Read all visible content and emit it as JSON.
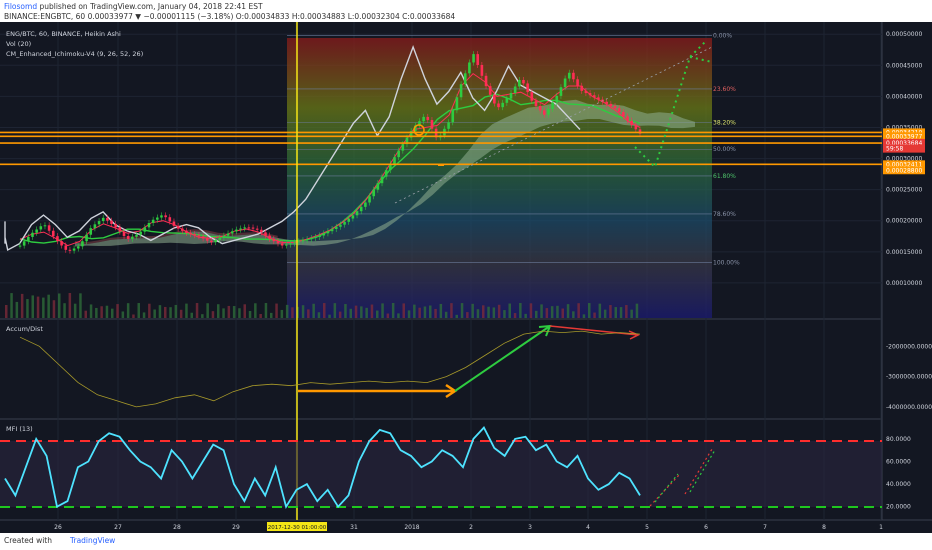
{
  "header": {
    "author": "Filosomd",
    "published": " published on TradingView.com, January 04, 2018 22:41 EST",
    "symbol_line": "BINANCE:ENGBTC, 60  0.00033977 ▼ −0.00001115 (−3.18%)  O:0.00034833  H:0.00034883  L:0.00032304  C:0.00033684"
  },
  "footer": {
    "created_with": "Created with",
    "brand": "TradingView"
  },
  "legend": {
    "title": "ENG/BTC, 60, BINANCE, Heikin Ashi",
    "vol": "Vol (20)",
    "ichimoku": "CM_Enhanced_Ichimoku-V4 (9, 26, 52, 26)",
    "accum": "Accum/Dist",
    "mfi": "MFI (13)"
  },
  "colors": {
    "background": "#131722",
    "price_line": "#cfd3dc",
    "ichimoku_green": "#2ecc40",
    "ichimoku_red": "#ff2d55",
    "fib_orange": "#ff9800",
    "vertical_marker": "#f5e616",
    "mfi": "#4ee3ff",
    "mfi_upper": "#ff2d2d",
    "mfi_lower": "#1fc71f"
  },
  "chart_data": [
    {
      "type": "line",
      "title": "ENG/BTC, 60, BINANCE, Heikin Ashi",
      "x_ticks": [
        "26",
        "27",
        "28",
        "29",
        "30",
        "31",
        "2018",
        "2",
        "3",
        "4",
        "5",
        "6",
        "7",
        "8",
        "1"
      ],
      "y_ticks": [
        "0.00050000",
        "0.00045000",
        "0.00040000",
        "0.00035000",
        "0.00030000",
        "0.00025000",
        "0.00020000",
        "0.00015000",
        "0.00010000"
      ],
      "ylim": [
        5e-05,
        0.00051
      ],
      "price_labels": [
        {
          "text": "0.00034210",
          "bg": "#ff9800",
          "value": 0.0003421
        },
        {
          "text": "0.00033977",
          "bg": "#ff9800",
          "value": 0.0003358
        },
        {
          "text": "0.00033684",
          "bg": "#e53935",
          "value": 0.0003252
        },
        {
          "text": "59:58",
          "bg": "#e53935",
          "value": 0.000316
        },
        {
          "text": "0.00032411",
          "bg": "#ff9800",
          "value": 0.0002907
        },
        {
          "text": "0.00028800",
          "bg": "#ff9800",
          "value": 0.0002812
        }
      ],
      "fib_levels": [
        {
          "label": "0.00%",
          "value": 0.000498
        },
        {
          "label": "23.60%",
          "value": 0.000412
        },
        {
          "label": "38.20%",
          "value": 0.000358
        },
        {
          "label": "50.00%",
          "value": 0.000315
        },
        {
          "label": "61.80%",
          "value": 0.000272
        },
        {
          "label": "78.60%",
          "value": 0.000211
        },
        {
          "label": "100.00%",
          "value": 0.000133
        }
      ],
      "series": [
        {
          "values": [
            0.00016,
            0.00018,
            0.000195,
            0.00017,
            0.00015,
            0.00016,
            0.00019,
            0.000205,
            0.00019,
            0.00017,
            0.00018,
            0.0002,
            0.00021,
            0.00019,
            0.00018,
            0.000175,
            0.000165,
            0.000175,
            0.000185,
            0.00019,
            0.000185,
            0.00017,
            0.00016,
            0.000165,
            0.00017,
            0.000175,
            0.000185,
            0.000195,
            0.00021,
            0.00023,
            0.00026,
            0.00029,
            0.00032,
            0.00035,
            0.00037,
            0.00033,
            0.00036,
            0.00042,
            0.00047,
            0.00042,
            0.00038,
            0.0004,
            0.00043,
            0.00039,
            0.00037,
            0.0004,
            0.00044,
            0.00041,
            0.0004,
            0.00039,
            0.00038,
            0.00036,
            0.00034
          ]
        }
      ]
    },
    {
      "type": "line",
      "title": "Accum/Dist",
      "y_ticks": [
        "-2000000.0000",
        "-3000000.0000",
        "-4000000.0000"
      ],
      "ylim": [
        -4300000,
        -1200000
      ],
      "series": [
        {
          "values": [
            -1700000,
            -2000000,
            -2600000,
            -3200000,
            -3600000,
            -3800000,
            -4000000,
            -3900000,
            -3700000,
            -3600000,
            -3800000,
            -3500000,
            -3300000,
            -3250000,
            -3300000,
            -3200000,
            -3250000,
            -3200000,
            -3150000,
            -3200000,
            -3150000,
            -3200000,
            -3000000,
            -2700000,
            -2300000,
            -1900000,
            -1600000,
            -1500000,
            -1550000,
            -1500000,
            -1600000,
            -1550000,
            -1600000
          ]
        }
      ]
    },
    {
      "type": "line",
      "title": "MFI (13)",
      "y_ticks": [
        "80.0000",
        "60.0000",
        "40.0000",
        "20.0000"
      ],
      "ylim": [
        10,
        95
      ],
      "bands": {
        "upper": 80,
        "lower": 20
      },
      "series": [
        {
          "values": [
            45,
            30,
            55,
            80,
            65,
            20,
            25,
            55,
            60,
            78,
            85,
            82,
            70,
            60,
            55,
            45,
            70,
            60,
            45,
            60,
            75,
            70,
            40,
            25,
            45,
            30,
            55,
            20,
            35,
            40,
            25,
            35,
            20,
            30,
            60,
            78,
            88,
            85,
            70,
            65,
            55,
            60,
            70,
            65,
            55,
            80,
            90,
            72,
            65,
            80,
            82,
            70,
            75,
            60,
            55,
            65,
            45,
            35,
            40,
            50,
            45,
            30
          ]
        }
      ]
    }
  ],
  "marker_date": "2017-12-30  01:00:00"
}
